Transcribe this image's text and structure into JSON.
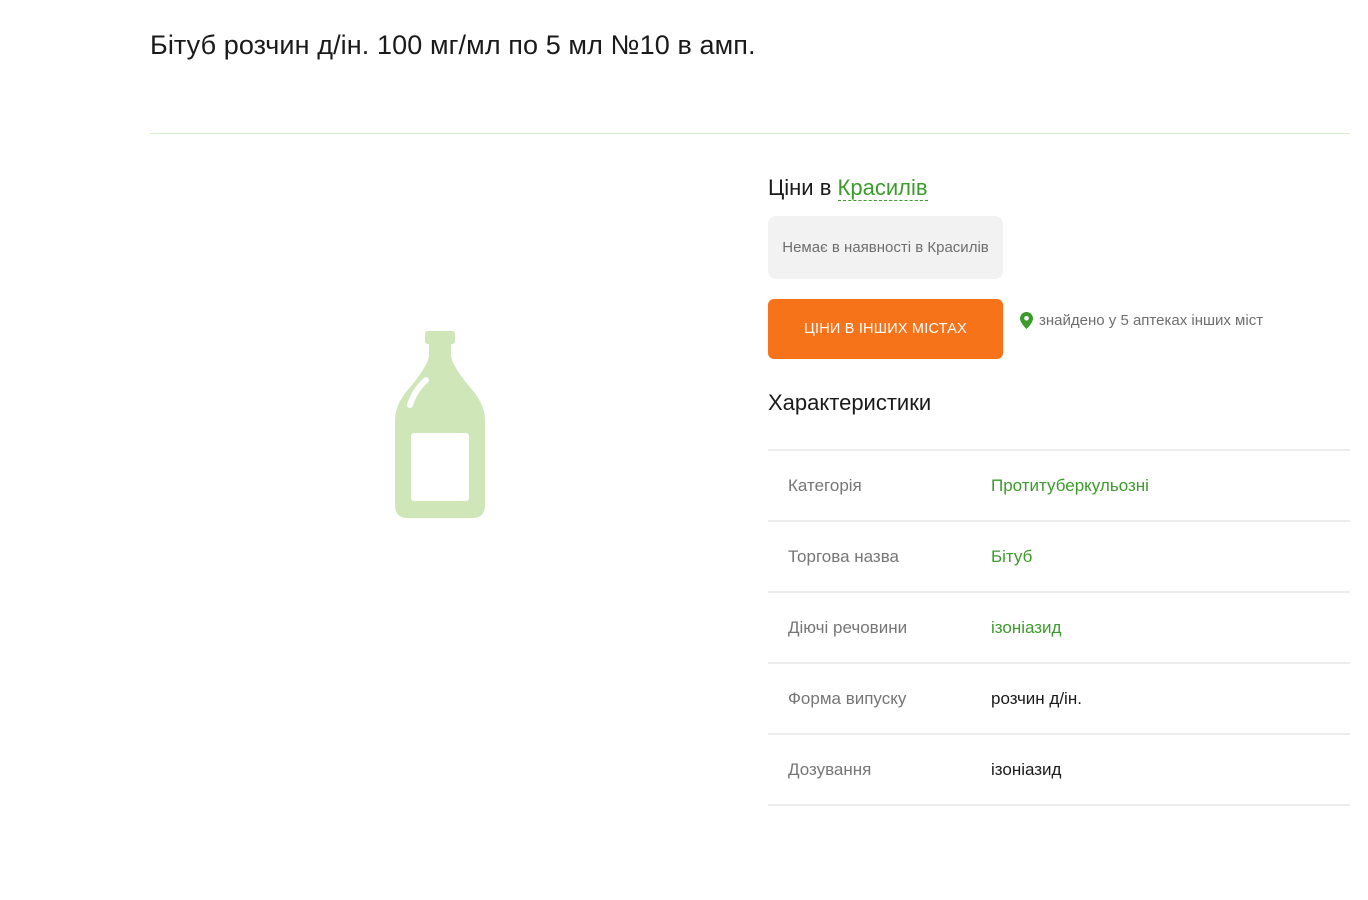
{
  "product": {
    "title": "Бітуб розчин д/ін. 100 мг/мл по 5 мл №10 в амп."
  },
  "prices": {
    "heading_prefix": "Ціни в",
    "city": "Красилів",
    "availability": "Немає в наявності в Красилів",
    "other_cities_button": "ЦІНИ В ІНШИХ МІСТАХ",
    "found_text": "знайдено у 5 аптеках інших міст"
  },
  "specs": {
    "heading": "Характеристики",
    "rows": [
      {
        "label": "Категорія",
        "value": "Протитуберкульозні"
      },
      {
        "label": "Торгова назва",
        "value": "Бітуб"
      },
      {
        "label": "Діючі речовини",
        "value": "ізоніазид"
      },
      {
        "label": "Форма випуску",
        "value": "розчин д/ін."
      },
      {
        "label": "Дозування",
        "value": "ізоніазид"
      }
    ]
  },
  "icons": {
    "product_placeholder": "bottle-icon",
    "location": "map-pin-icon"
  },
  "colors": {
    "accent_green": "#3d9a2c",
    "button_orange": "#f7731a",
    "placeholder_green": "#cfe6b8"
  }
}
